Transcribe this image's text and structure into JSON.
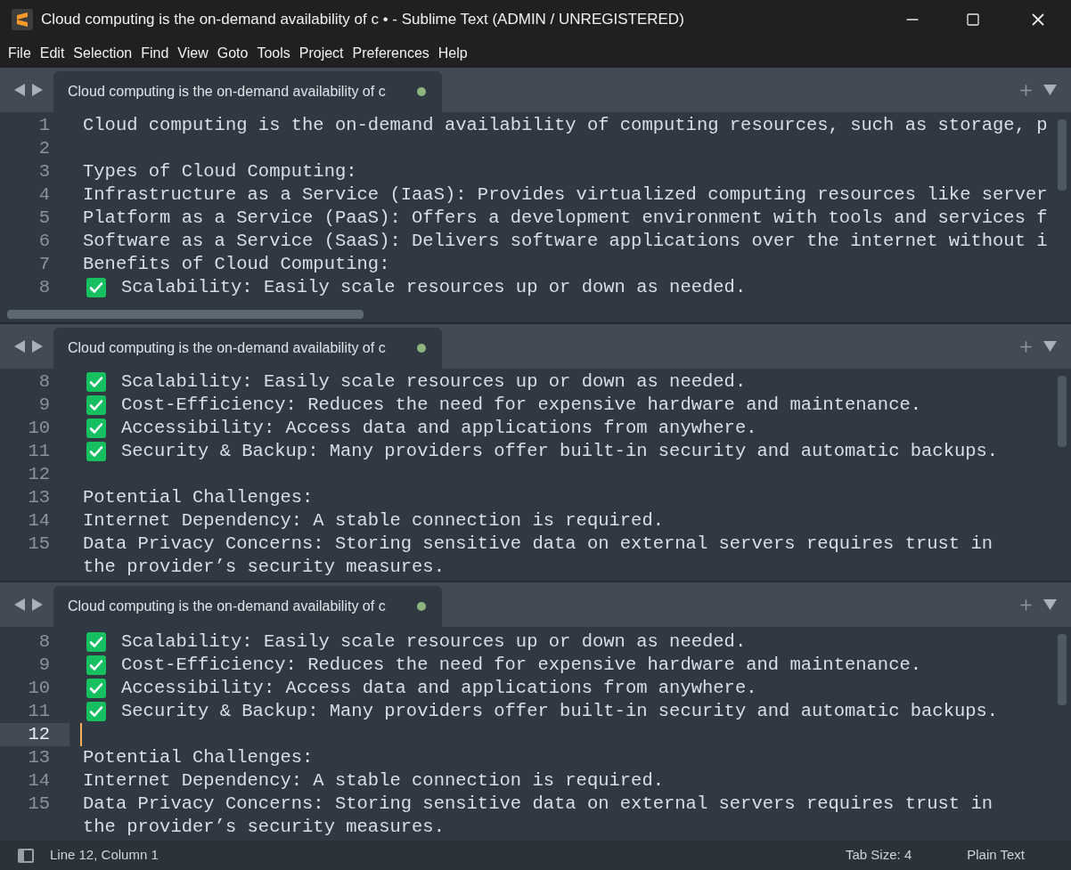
{
  "window": {
    "title": "Cloud computing is the on-demand availability of c • - Sublime Text (ADMIN / UNREGISTERED)"
  },
  "menu": [
    "File",
    "Edit",
    "Selection",
    "Find",
    "View",
    "Goto",
    "Tools",
    "Project",
    "Preferences",
    "Help"
  ],
  "panes": [
    {
      "tab": {
        "label": "Cloud computing is the on-demand availability of c",
        "selected": true,
        "modified": true
      },
      "top_gap": false,
      "lines": [
        {
          "number": "1",
          "kind": "text",
          "text": "Cloud computing is the on-demand availability of computing resources, such as storage, p",
          "current": false
        },
        {
          "number": "2",
          "kind": "text",
          "current": false
        },
        {
          "number": "3",
          "kind": "text",
          "text": "Types of Cloud Computing:",
          "current": false
        },
        {
          "number": "4",
          "kind": "text",
          "text": "Infrastructure as a Service (IaaS): Provides virtualized computing resources like server",
          "current": false
        },
        {
          "number": "5",
          "kind": "text",
          "text": "Platform as a Service (PaaS): Offers a development environment with tools and services f",
          "current": false
        },
        {
          "number": "6",
          "kind": "text",
          "text": "Software as a Service (SaaS): Delivers software applications over the internet without i",
          "current": false
        },
        {
          "number": "7",
          "kind": "text",
          "text": "Benefits of Cloud Computing:",
          "current": false
        },
        {
          "number": "8",
          "kind": "check",
          "text": "Scalability: Easily scale resources up or down as needed.",
          "current": false
        }
      ]
    },
    {
      "tab": {
        "label": "Cloud computing is the on-demand availability of c",
        "selected": true,
        "modified": true
      },
      "top_gap": false,
      "lines": [
        {
          "number": "8",
          "kind": "check",
          "text": "Scalability: Easily scale resources up or down as needed.",
          "current": false
        },
        {
          "number": "9",
          "kind": "check",
          "text": "Cost-Efficiency: Reduces the need for expensive hardware and maintenance.",
          "current": false
        },
        {
          "number": "10",
          "kind": "check",
          "text": "Accessibility: Access data and applications from anywhere.",
          "current": false
        },
        {
          "number": "11",
          "kind": "check",
          "text": "Security & Backup: Many providers offer built-in security and automatic backups.",
          "current": false
        },
        {
          "number": "12",
          "kind": "text",
          "current": false
        },
        {
          "number": "13",
          "kind": "text",
          "text": "Potential Challenges:",
          "current": false
        },
        {
          "number": "14",
          "kind": "text",
          "text": "Internet Dependency: A stable connection is required.",
          "current": false
        },
        {
          "number": "15",
          "kind": "text",
          "text": "Data Privacy Concerns: Storing sensitive data on external servers requires trust in",
          "current": false
        },
        {
          "kind": "text",
          "text": "the provider’s security measures.",
          "current": false
        }
      ]
    },
    {
      "tab": {
        "label": "Cloud computing is the on-demand availability of c",
        "selected": true,
        "modified": true
      },
      "top_gap": true,
      "lines": [
        {
          "number": "8",
          "kind": "check",
          "text": "Scalability: Easily scale resources up or down as needed.",
          "current": false
        },
        {
          "number": "9",
          "kind": "check",
          "text": "Cost-Efficiency: Reduces the need for expensive hardware and maintenance.",
          "current": false
        },
        {
          "number": "10",
          "kind": "check",
          "text": "Accessibility: Access data and applications from anywhere.",
          "current": false
        },
        {
          "number": "11",
          "kind": "check",
          "text": "Security & Backup: Many providers offer built-in security and automatic backups.",
          "current": false
        },
        {
          "number": "12",
          "kind": "text",
          "current": true
        },
        {
          "number": "13",
          "kind": "text",
          "text": "Potential Challenges:",
          "current": false
        },
        {
          "number": "14",
          "kind": "text",
          "text": "Internet Dependency: A stable connection is required.",
          "current": false
        },
        {
          "number": "15",
          "kind": "text",
          "text": "Data Privacy Concerns: Storing sensitive data on external servers requires trust in",
          "current": false
        },
        {
          "kind": "text",
          "text": "the provider’s security measures.",
          "current": false
        }
      ]
    }
  ],
  "status_bar": {
    "position": "Line 12, Column 1",
    "tab_size": "Tab Size: 4",
    "syntax": "Plain Text"
  }
}
